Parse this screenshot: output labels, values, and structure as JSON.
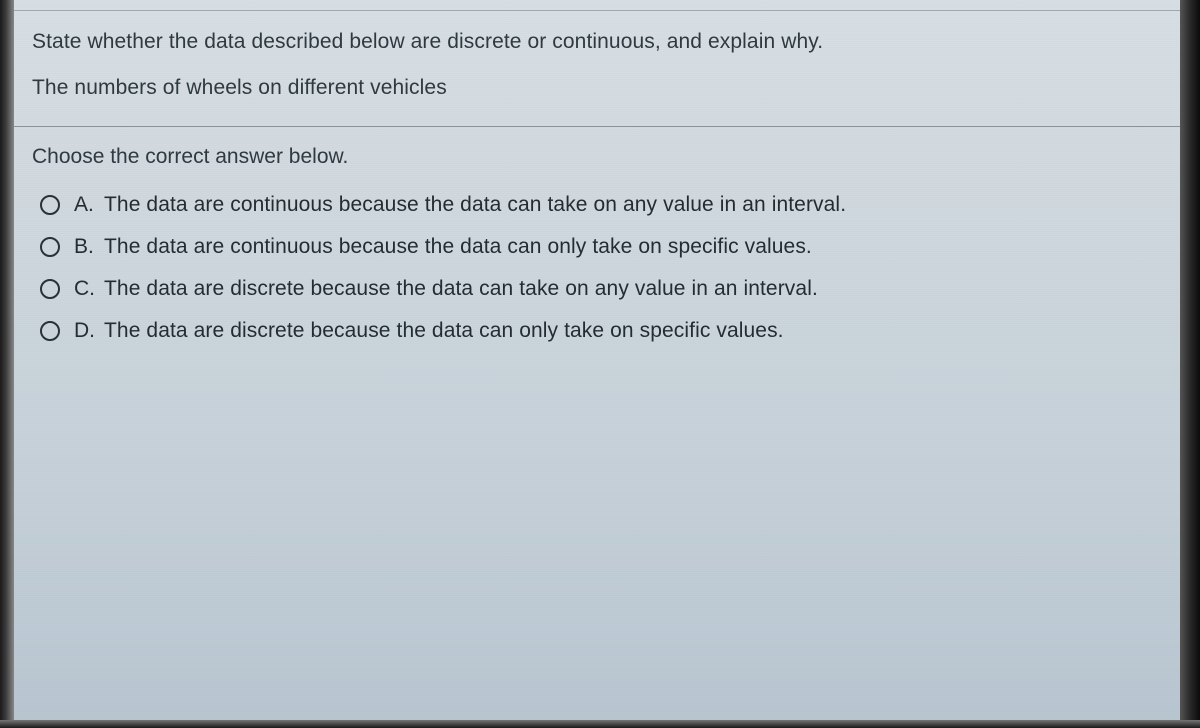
{
  "question": {
    "prompt_line1": "State whether the data described below are discrete or continuous, and explain why.",
    "prompt_line2": "The numbers of wheels on different vehicles"
  },
  "instruction": "Choose the correct answer below.",
  "options": [
    {
      "letter": "A.",
      "text": "The data are continuous because the data can take on any value in an interval."
    },
    {
      "letter": "B.",
      "text": "The data are continuous because the data can only take on specific values."
    },
    {
      "letter": "C.",
      "text": "The data are discrete because the data can take on any value in an interval."
    },
    {
      "letter": "D.",
      "text": "The data are discrete because the data can only take on specific values."
    }
  ]
}
